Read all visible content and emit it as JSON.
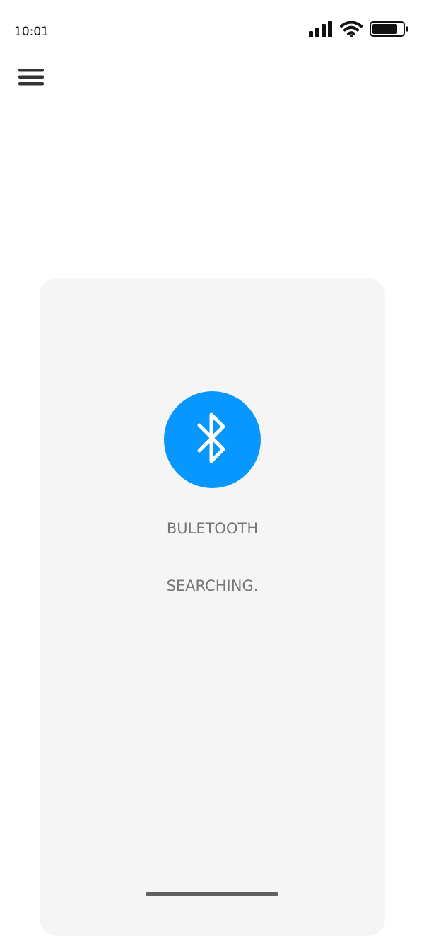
{
  "status_bar": {
    "time": "10:01",
    "icons": [
      "signal-icon",
      "wifi-icon",
      "battery-icon"
    ]
  },
  "header": {
    "menu_icon": "hamburger-menu-icon"
  },
  "bluetooth_card": {
    "icon": "bluetooth-icon",
    "title": "BULETOOTH",
    "status": "SEARCHING."
  },
  "colors": {
    "accent": "#0896FF",
    "panel_background": "#F5F5F5",
    "label_text": "#777777"
  }
}
